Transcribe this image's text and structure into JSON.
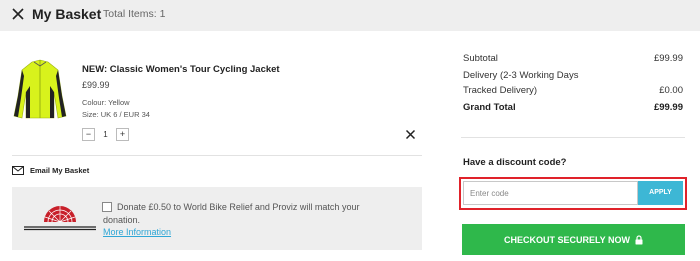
{
  "header": {
    "close_icon": "close-icon",
    "title": "My Basket",
    "total_items": "Total Items: 1"
  },
  "basket": {
    "item": {
      "name": "NEW: Classic Women's Tour Cycling Jacket",
      "price": "£99.99",
      "colour": "Colour: Yellow",
      "size": "Size: UK 6 / EUR 34",
      "quantity": "1",
      "decrease_label": "−",
      "increase_label": "+",
      "image_icon": "cycling-jacket-image"
    },
    "email_label": "Email My Basket",
    "charity": {
      "text": "Donate £0.50 to World Bike Relief and Proviz will match your donation.",
      "link": "More Information",
      "logo_icon": "world-bicycle-relief-logo"
    }
  },
  "summary": {
    "subtotal_label": "Subtotal",
    "subtotal_value": "£99.99",
    "delivery_label_1": "Delivery (2-3 Working Days",
    "delivery_label_2": "Tracked Delivery)",
    "delivery_value": "£0.00",
    "grand_label": "Grand Total",
    "grand_value": "£99.99"
  },
  "discount": {
    "title": "Have a discount code?",
    "placeholder": "Enter code",
    "apply_label": "APPLY"
  },
  "checkout": {
    "label": "CHECKOUT SECURELY NOW"
  },
  "colors": {
    "header_bg": "#eeeeee",
    "apply": "#3db7d5",
    "checkout": "#2fb84b",
    "highlight": "#e0222a",
    "jacket": "#d8f21c"
  }
}
